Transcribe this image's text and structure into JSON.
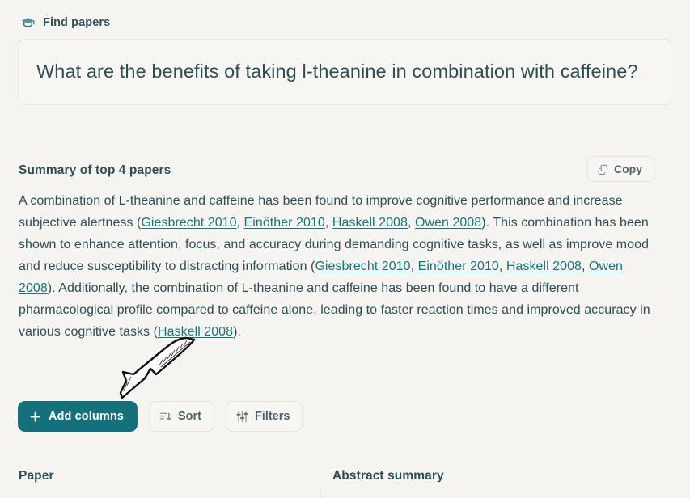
{
  "app": {
    "header_label": "Find papers",
    "header_icon": "graduation-cap-icon"
  },
  "question": {
    "text": "What are the benefits of taking l-theanine in combination with caffeine?"
  },
  "summary": {
    "title": "Summary of top 4 papers",
    "copy_label": "Copy",
    "copy_icon": "copy-icon",
    "segments": [
      {
        "type": "text",
        "value": "A combination of L-theanine and caffeine has been found to improve cognitive performance and increase subjective alertness ("
      },
      {
        "type": "link",
        "value": "Giesbrecht 2010"
      },
      {
        "type": "text",
        "value": ", "
      },
      {
        "type": "link",
        "value": "Einöther 2010"
      },
      {
        "type": "text",
        "value": ", "
      },
      {
        "type": "link",
        "value": "Haskell 2008"
      },
      {
        "type": "text",
        "value": ", "
      },
      {
        "type": "link",
        "value": "Owen 2008"
      },
      {
        "type": "text",
        "value": "). This combination has been shown to enhance attention, focus, and accuracy during demanding cognitive tasks, as well as improve mood and reduce susceptibility to distracting information ("
      },
      {
        "type": "link",
        "value": "Giesbrecht 2010"
      },
      {
        "type": "text",
        "value": ", "
      },
      {
        "type": "link",
        "value": "Einöther 2010"
      },
      {
        "type": "text",
        "value": ", "
      },
      {
        "type": "link",
        "value": "Haskell 2008"
      },
      {
        "type": "text",
        "value": ", "
      },
      {
        "type": "link",
        "value": "Owen 2008"
      },
      {
        "type": "text",
        "value": "). Additionally, the combination of L-theanine and caffeine has been found to have a different pharmacological profile compared to caffeine alone, leading to faster reaction times and improved accuracy in various cognitive tasks ("
      },
      {
        "type": "link",
        "value": "Haskell 2008"
      },
      {
        "type": "text",
        "value": ")."
      }
    ]
  },
  "annotation": {
    "type": "hand-drawn-arrow",
    "points_to": "add-columns-button"
  },
  "actions": {
    "add_columns_label": "Add columns",
    "add_columns_icon": "plus-icon",
    "sort_label": "Sort",
    "sort_icon": "sort-descending-icon",
    "filters_label": "Filters",
    "filters_icon": "sliders-icon"
  },
  "table": {
    "columns": [
      {
        "label": "Paper"
      },
      {
        "label": "Abstract summary"
      }
    ]
  },
  "colors": {
    "page_background": "#f5f4f1",
    "accent_teal": "#14707a",
    "link_teal": "#14757f",
    "text_primary": "#2e4d55",
    "border": "#e6e4df"
  }
}
